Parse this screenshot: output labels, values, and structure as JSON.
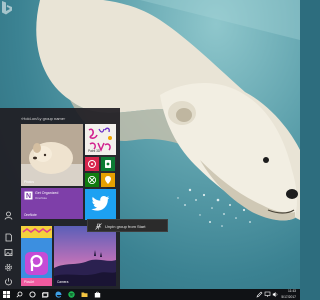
{
  "desktop": {
    "wallpaper": "polar bear swimming underwater",
    "watermark_icon": "bing-logo-icon"
  },
  "start_menu": {
    "group_label": "‹Hold-on/Ly group name›",
    "rail_icons": [
      "avatar-icon",
      "document-icon",
      "pictures-icon",
      "settings-icon",
      "power-icon"
    ],
    "tiles": {
      "photos": {
        "label": "Photos"
      },
      "ms_paint": {
        "label": "Paint 3D"
      },
      "onenote": {
        "title": "Get Organized",
        "subtitle": "OneNote",
        "label": "OneNote"
      },
      "twitter": {
        "label": "Twitter"
      },
      "picsart": {
        "label": "PicsArt"
      },
      "camera": {
        "label": "Camera"
      },
      "small_tiles": [
        "Groove",
        "Solitaire",
        "Xbox"
      ]
    },
    "context_menu": {
      "unpin_label": "Unpin group from Start"
    }
  },
  "taskbar": {
    "start_icon": "windows-logo-icon",
    "items": [
      "search-icon",
      "cortana-icon",
      "task-view-icon",
      "edge-icon",
      "spotify-icon",
      "file-explorer-icon",
      "store-icon"
    ],
    "tray_icons": [
      "pen-icon",
      "network-icon",
      "volume-icon",
      "notification-icon"
    ],
    "clock": {
      "time": "11:43",
      "date": "5/17/2017"
    }
  },
  "colors": {
    "accent": "#0078d7",
    "taskbar": "#101215",
    "menu": "#201e24"
  }
}
